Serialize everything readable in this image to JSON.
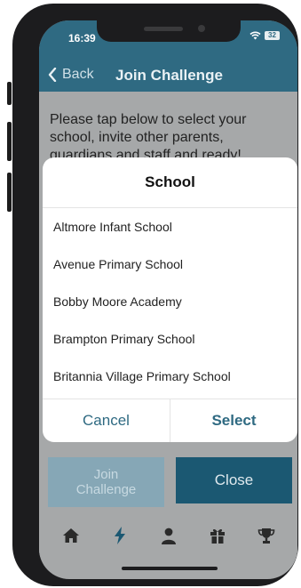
{
  "status": {
    "time": "16:39",
    "battery": "32"
  },
  "nav": {
    "back_label": "Back",
    "title": "Join Challenge"
  },
  "content": {
    "instructions": "Please tap below to select your school, invite other parents, guardians and staff and ready!"
  },
  "picker": {
    "title": "School",
    "options": [
      "Altmore Infant School",
      "Avenue Primary School",
      "Bobby Moore Academy",
      "Brampton Primary School",
      "Britannia Village Primary School"
    ],
    "cancel_label": "Cancel",
    "select_label": "Select"
  },
  "buttons": {
    "join_label": "Join\nChallenge",
    "close_label": "Close"
  },
  "tabbar": {
    "items": [
      {
        "icon": "home-icon",
        "active": false
      },
      {
        "icon": "lightning-icon",
        "active": true
      },
      {
        "icon": "person-icon",
        "active": false
      },
      {
        "icon": "gift-icon",
        "active": false
      },
      {
        "icon": "trophy-icon",
        "active": false
      }
    ]
  },
  "colors": {
    "primary": "#2f6a82",
    "close_button": "#1b5872",
    "join_disabled": "#86a7b6",
    "overlay": "#a6a8a9"
  }
}
